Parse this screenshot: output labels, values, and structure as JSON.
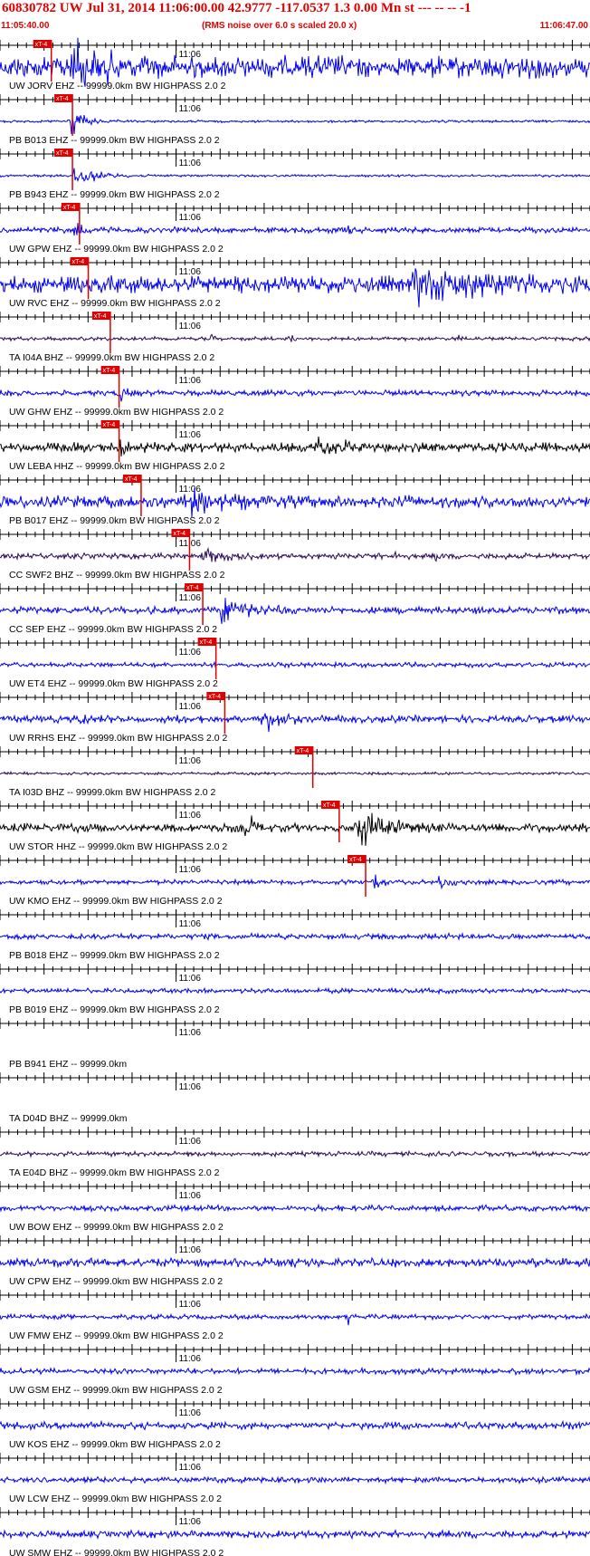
{
  "header": {
    "title": "60830782 UW Jul 31, 2014 11:06:00.00   42.9777 -117.0537  1.3 0.00 Mn st --- -- --  -1",
    "start_time": "11:05:40.00",
    "rms_note": "(RMS noise over 6.0 s scaled 20.0 x)",
    "end_time": "11:06:47.00"
  },
  "colors": {
    "header_text": "#e00000",
    "pick": "#e00000",
    "trace_blue": "#0000ee",
    "trace_purple": "#2a0a55",
    "trace_black": "#000000",
    "axis": "#000000"
  },
  "chart_data": {
    "type": "line",
    "x_start": "11:05:40.00",
    "x_end": "11:06:47.00",
    "minute_tick_label": "11:06",
    "pick_label": "xT-4",
    "traces": [
      {
        "label": "UW JORV EHZ -- 99999.0km BW  HIGHPASS  2.0  2",
        "color": "blue",
        "amp": 0.45,
        "flat": false,
        "pick": 4.8,
        "bursts": [
          [
            8.0,
            0.85,
            6.5
          ]
        ]
      },
      {
        "label": "PB B013 EHZ -- 99999.0km BW  HIGHPASS  2.0  2",
        "color": "blue",
        "amp": 0.05,
        "flat": false,
        "pick": 7.2,
        "bursts": [
          [
            8.0,
            0.7,
            2.5
          ]
        ]
      },
      {
        "label": "PB B943 EHZ -- 99999.0km BW  HIGHPASS  2.0  2",
        "color": "blue",
        "amp": 0.05,
        "flat": false,
        "pick": 7.2,
        "bursts": [
          [
            8.5,
            0.55,
            4.0
          ]
        ]
      },
      {
        "label": "UW GPW EHZ -- 99999.0km BW  HIGHPASS  2.0  2",
        "color": "blue",
        "amp": 0.12,
        "flat": false,
        "pick": 8.0,
        "bursts": [
          [
            8.5,
            0.3,
            1.5
          ],
          [
            39.5,
            0.3,
            0.8
          ]
        ]
      },
      {
        "label": "UW RVC EHZ -- 99999.0km BW  HIGHPASS  2.0  2",
        "color": "blue",
        "amp": 0.35,
        "flat": false,
        "pick": 9.0,
        "bursts": [
          [
            47.0,
            0.55,
            14.0
          ]
        ]
      },
      {
        "label": "TA I04A BHZ -- 99999.0km BW  HIGHPASS  2.0  2",
        "color": "purple",
        "amp": 0.08,
        "flat": false,
        "pick": 11.5,
        "bursts": [
          [
            24.0,
            0.2,
            0.5
          ],
          [
            33.0,
            0.2,
            0.5
          ],
          [
            52.0,
            0.2,
            0.5
          ]
        ]
      },
      {
        "label": "UW GHW EHZ -- 99999.0km BW  HIGHPASS  2.0  2",
        "color": "blue",
        "amp": 0.12,
        "flat": false,
        "pick": 12.5,
        "bursts": [
          [
            13.5,
            0.55,
            1.0
          ]
        ]
      },
      {
        "label": "UW LEBA HHZ -- 99999.0km BW  HIGHPASS  2.0  2",
        "color": "black",
        "amp": 0.2,
        "flat": false,
        "pick": 12.5,
        "bursts": [
          [
            13.5,
            0.5,
            1.2
          ],
          [
            36.0,
            0.35,
            6.0
          ]
        ]
      },
      {
        "label": "PB B017 EHZ -- 99999.0km BW  HIGHPASS  2.0  2",
        "color": "blue",
        "amp": 0.25,
        "flat": false,
        "pick": 15.0,
        "bursts": [
          [
            21.0,
            0.5,
            7.0
          ]
        ]
      },
      {
        "label": "CC SWF2 BHZ -- 99999.0km BW  HIGHPASS  2.0  2",
        "color": "purple",
        "amp": 0.12,
        "flat": false,
        "pick": 20.5,
        "bursts": [
          [
            23.0,
            0.35,
            3.5
          ],
          [
            45.0,
            0.3,
            0.7
          ],
          [
            49.5,
            0.35,
            0.7
          ]
        ]
      },
      {
        "label": "CC SEP EHZ -- 99999.0km BW  HIGHPASS  2.0  2",
        "color": "blue",
        "amp": 0.15,
        "flat": false,
        "pick": 22.0,
        "bursts": [
          [
            25.0,
            0.5,
            6.0
          ]
        ]
      },
      {
        "label": "UW ET4 EHZ -- 99999.0km BW  HIGHPASS  2.0  2",
        "color": "blue",
        "amp": 0.1,
        "flat": false,
        "pick": 23.5,
        "bursts": []
      },
      {
        "label": "UW RRHS EHZ -- 99999.0km BW  HIGHPASS  2.0  2",
        "color": "blue",
        "amp": 0.15,
        "flat": false,
        "pick": 24.5,
        "bursts": [
          [
            30.0,
            0.55,
            3.0
          ],
          [
            9.0,
            0.3,
            1.5
          ],
          [
            20.0,
            0.25,
            2.0
          ]
        ]
      },
      {
        "label": "TA I03D BHZ -- 99999.0km BW  HIGHPASS  2.0  2",
        "color": "purple",
        "amp": 0.06,
        "flat": false,
        "pick": 34.5,
        "bursts": []
      },
      {
        "label": "UW STOR HHZ -- 99999.0km BW  HIGHPASS  2.0  2",
        "color": "black",
        "amp": 0.18,
        "flat": false,
        "pick": 37.5,
        "bursts": [
          [
            28.0,
            0.5,
            2.0
          ],
          [
            40.5,
            0.7,
            6.0
          ]
        ]
      },
      {
        "label": "UW KMO EHZ -- 99999.0km BW  HIGHPASS  2.0  2",
        "color": "blue",
        "amp": 0.1,
        "flat": false,
        "pick": 40.5,
        "bursts": [
          [
            42.5,
            0.35,
            1.5
          ],
          [
            50.0,
            0.4,
            1.5
          ]
        ]
      },
      {
        "label": "PB B018 EHZ -- 99999.0km BW  HIGHPASS  2.0  2",
        "color": "blue",
        "amp": 0.12,
        "flat": false,
        "pick": null,
        "bursts": []
      },
      {
        "label": "PB B019 EHZ -- 99999.0km BW  HIGHPASS  2.0  2",
        "color": "blue",
        "amp": 0.1,
        "flat": false,
        "pick": null,
        "bursts": []
      },
      {
        "label": "PB B941 EHZ -- 99999.0km",
        "color": "blue",
        "amp": 0.0,
        "flat": true,
        "pick": null,
        "bursts": []
      },
      {
        "label": "TA D04D BHZ -- 99999.0km",
        "color": "blue",
        "amp": 0.0,
        "flat": true,
        "pick": null,
        "bursts": []
      },
      {
        "label": "TA E04D BHZ -- 99999.0km BW  HIGHPASS  2.0  2",
        "color": "purple",
        "amp": 0.1,
        "flat": false,
        "pick": null,
        "bursts": []
      },
      {
        "label": "UW BOW EHZ -- 99999.0km BW  HIGHPASS  2.0  2",
        "color": "blue",
        "amp": 0.12,
        "flat": false,
        "pick": null,
        "bursts": []
      },
      {
        "label": "UW CPW EHZ -- 99999.0km BW  HIGHPASS  2.0  2",
        "color": "blue",
        "amp": 0.18,
        "flat": false,
        "pick": null,
        "bursts": []
      },
      {
        "label": "UW FMW EHZ -- 99999.0km BW  HIGHPASS  2.0  2",
        "color": "blue",
        "amp": 0.1,
        "flat": false,
        "pick": null,
        "bursts": [
          [
            39.5,
            0.4,
            0.6
          ]
        ]
      },
      {
        "label": "UW GSM EHZ -- 99999.0km BW  HIGHPASS  2.0  2",
        "color": "blue",
        "amp": 0.12,
        "flat": false,
        "pick": null,
        "bursts": []
      },
      {
        "label": "UW KOS EHZ -- 99999.0km BW  HIGHPASS  2.0  2",
        "color": "blue",
        "amp": 0.15,
        "flat": false,
        "pick": null,
        "bursts": []
      },
      {
        "label": "UW LCW EHZ -- 99999.0km BW  HIGHPASS  2.0  2",
        "color": "blue",
        "amp": 0.12,
        "flat": false,
        "pick": null,
        "bursts": []
      },
      {
        "label": "UW SMW EHZ -- 99999.0km BW  HIGHPASS  2.0  2",
        "color": "blue",
        "amp": 0.15,
        "flat": false,
        "pick": null,
        "bursts": []
      }
    ]
  }
}
